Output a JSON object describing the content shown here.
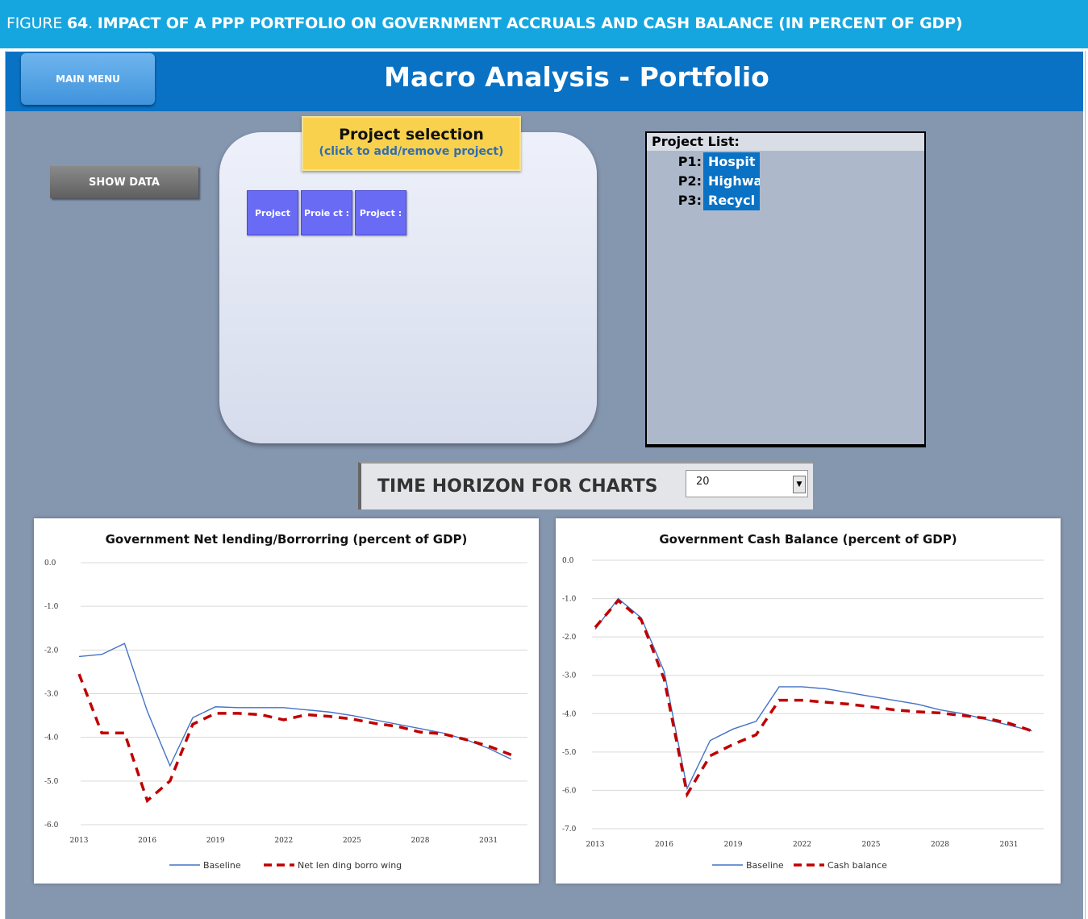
{
  "caption": {
    "figure_label": "FIGURE",
    "figure_number": "64",
    "figure_title": "IMPACT OF A PPP PORTFOLIO ON GOVERNMENT ACCRUALS AND CASH BALANCE (IN PERCENT OF GDP)"
  },
  "header": {
    "main_menu_label": "MAIN MENU",
    "title": "Macro Analysis - Portfolio"
  },
  "controls": {
    "show_data_label": "SHOW DATA"
  },
  "project_selection": {
    "title": "Project selection",
    "subtitle": "(click to add/remove project)",
    "buttons": [
      "Project",
      "Proie ct :",
      "Project :"
    ]
  },
  "project_list": {
    "header": "Project List:",
    "items": [
      {
        "code": "P1:",
        "name": "Hospit"
      },
      {
        "code": "P2:",
        "name": "Highwa"
      },
      {
        "code": "P3:",
        "name": "Recycl"
      }
    ]
  },
  "time_horizon": {
    "label": "TIME HORIZON FOR CHARTS",
    "value": "20"
  },
  "colors": {
    "baseline": "#4472c4",
    "scenario": "#c00000",
    "header": "#0a72c4",
    "caption": "#15a6df"
  },
  "chart_data": [
    {
      "type": "line",
      "title": "Government Net lending/Borrorring (percent of GDP)",
      "x": [
        2013,
        2014,
        2015,
        2016,
        2017,
        2018,
        2019,
        2020,
        2021,
        2022,
        2023,
        2024,
        2025,
        2026,
        2027,
        2028,
        2029,
        2030,
        2031,
        2032
      ],
      "xticks": [
        "2013",
        "2016",
        "2019",
        "2022",
        "2025",
        "2028",
        "2031"
      ],
      "yticks": [
        "0.0",
        "-1.0",
        "-2.0",
        "-3.0",
        "-4.0",
        "-5.0",
        "-6.0"
      ],
      "ylim": [
        -6,
        0
      ],
      "grid": true,
      "legend": "bottom",
      "series": [
        {
          "name": "Baseline",
          "style": "solid",
          "values": [
            -2.15,
            -2.1,
            -1.85,
            -3.4,
            -4.65,
            -3.55,
            -3.3,
            -3.32,
            -3.32,
            -3.32,
            -3.37,
            -3.42,
            -3.5,
            -3.6,
            -3.7,
            -3.8,
            -3.9,
            -4.05,
            -4.25,
            -4.5
          ]
        },
        {
          "name": "Net len ding borro wing",
          "style": "dashed",
          "values": [
            -2.55,
            -3.9,
            -3.9,
            -5.45,
            -5.0,
            -3.7,
            -3.45,
            -3.45,
            -3.48,
            -3.6,
            -3.48,
            -3.52,
            -3.58,
            -3.68,
            -3.75,
            -3.88,
            -3.92,
            -4.05,
            -4.2,
            -4.4
          ]
        }
      ]
    },
    {
      "type": "line",
      "title": "Government Cash Balance (percent of GDP)",
      "x": [
        2013,
        2014,
        2015,
        2016,
        2017,
        2018,
        2019,
        2020,
        2021,
        2022,
        2023,
        2024,
        2025,
        2026,
        2027,
        2028,
        2029,
        2030,
        2031,
        2032
      ],
      "xticks": [
        "2013",
        "2016",
        "2019",
        "2022",
        "2025",
        "2028",
        "2031"
      ],
      "yticks": [
        "0.0",
        "-1.0",
        "-2.0",
        "-3.0",
        "-4.0",
        "-5.0",
        "-6.0",
        "-7.0"
      ],
      "ylim": [
        -7,
        0
      ],
      "grid": true,
      "legend": "bottom",
      "series": [
        {
          "name": "Baseline",
          "style": "solid",
          "values": [
            -1.8,
            -1.0,
            -1.5,
            -2.9,
            -5.95,
            -4.7,
            -4.4,
            -4.2,
            -3.3,
            -3.3,
            -3.35,
            -3.45,
            -3.55,
            -3.65,
            -3.75,
            -3.9,
            -4.0,
            -4.15,
            -4.3,
            -4.45
          ]
        },
        {
          "name": "Cash balance",
          "style": "dashed",
          "values": [
            -1.75,
            -1.05,
            -1.55,
            -3.1,
            -6.1,
            -5.1,
            -4.8,
            -4.55,
            -3.65,
            -3.65,
            -3.7,
            -3.75,
            -3.82,
            -3.9,
            -3.95,
            -3.98,
            -4.05,
            -4.12,
            -4.25,
            -4.45
          ]
        }
      ]
    }
  ]
}
